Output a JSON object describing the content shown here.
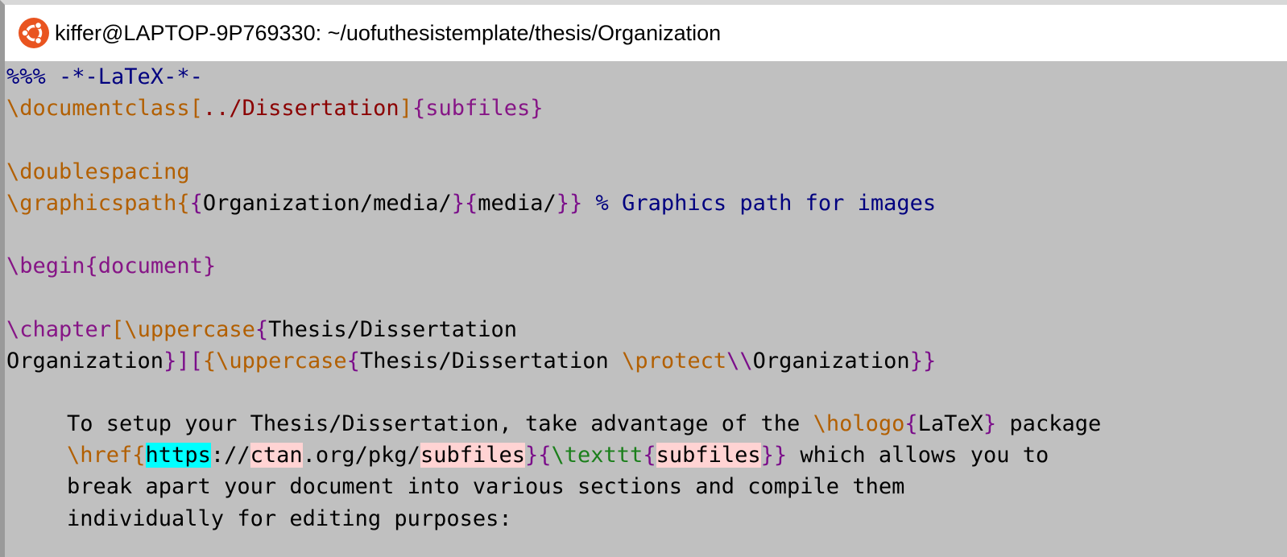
{
  "window": {
    "title": "kiffer@LAPTOP-9P769330: ~/uofuthesistemplate/thesis/Organization",
    "icon": "ubuntu-icon",
    "accent": "#e95420"
  },
  "colors": {
    "background": "#c0c0c0",
    "comment": "#00007f",
    "command": "#b25f00",
    "brace": "#7b0e8a",
    "option": "#8b0000",
    "texttt": "#1b7f1b",
    "highlight_cyan": "#00ffff",
    "highlight_pink": "#ffd3d3"
  },
  "editor": {
    "l1": {
      "comment": "%%% -*-LaTeX-*-"
    },
    "l2": {
      "cmd": "\\documentclass",
      "ob": "[",
      "opt": "../Dissertation",
      "cb": "]",
      "arg": "{subfiles}"
    },
    "l4": {
      "cmd": "\\doublespacing"
    },
    "l5": {
      "cmd": "\\graphicspath",
      "ob1": "{",
      "ob2": "{",
      "a1": "Organization/media/",
      "m": "}{",
      "a2": "media/",
      "cb": "}}",
      "comment": " % Graphics path for images"
    },
    "l7": {
      "cmd": "\\begin",
      "arg": "{document}"
    },
    "l9": {
      "cmd": "\\chapter",
      "ob": "[",
      "cmd2": "\\uppercase",
      "ob2": "{",
      "text": "Thesis/Dissertation"
    },
    "l10": {
      "text": "Organization",
      "b1": "}][",
      "b2": "{",
      "cmd": "\\uppercase",
      "b3": "{",
      "text2": "Thesis/Dissertation ",
      "cmd2": "\\protect",
      "cmd3": "\\\\",
      "text3": "Organization",
      "cb": "}}"
    },
    "l12": {
      "text": "To setup your Thesis/Dissertation, take advantage of the ",
      "cmd": "\\hologo",
      "ob": "{",
      "arg": "LaTeX",
      "cb": "}",
      "tail": " package"
    },
    "l13": {
      "cmd": "\\href",
      "ob": "{",
      "url_a": "https",
      "url_b": "://",
      "url_c": "ctan",
      "url_d": ".org/pkg/",
      "url_e": "subfiles",
      "m": "}{",
      "cmd2": "\\texttt",
      "ob2": "{",
      "arg": "subfiles",
      "cb": "}}",
      "tail": " which allows you to"
    },
    "l14": {
      "text": "break apart your document into various sections and compile them"
    },
    "l15": {
      "text": "individually for editing purposes:"
    }
  }
}
